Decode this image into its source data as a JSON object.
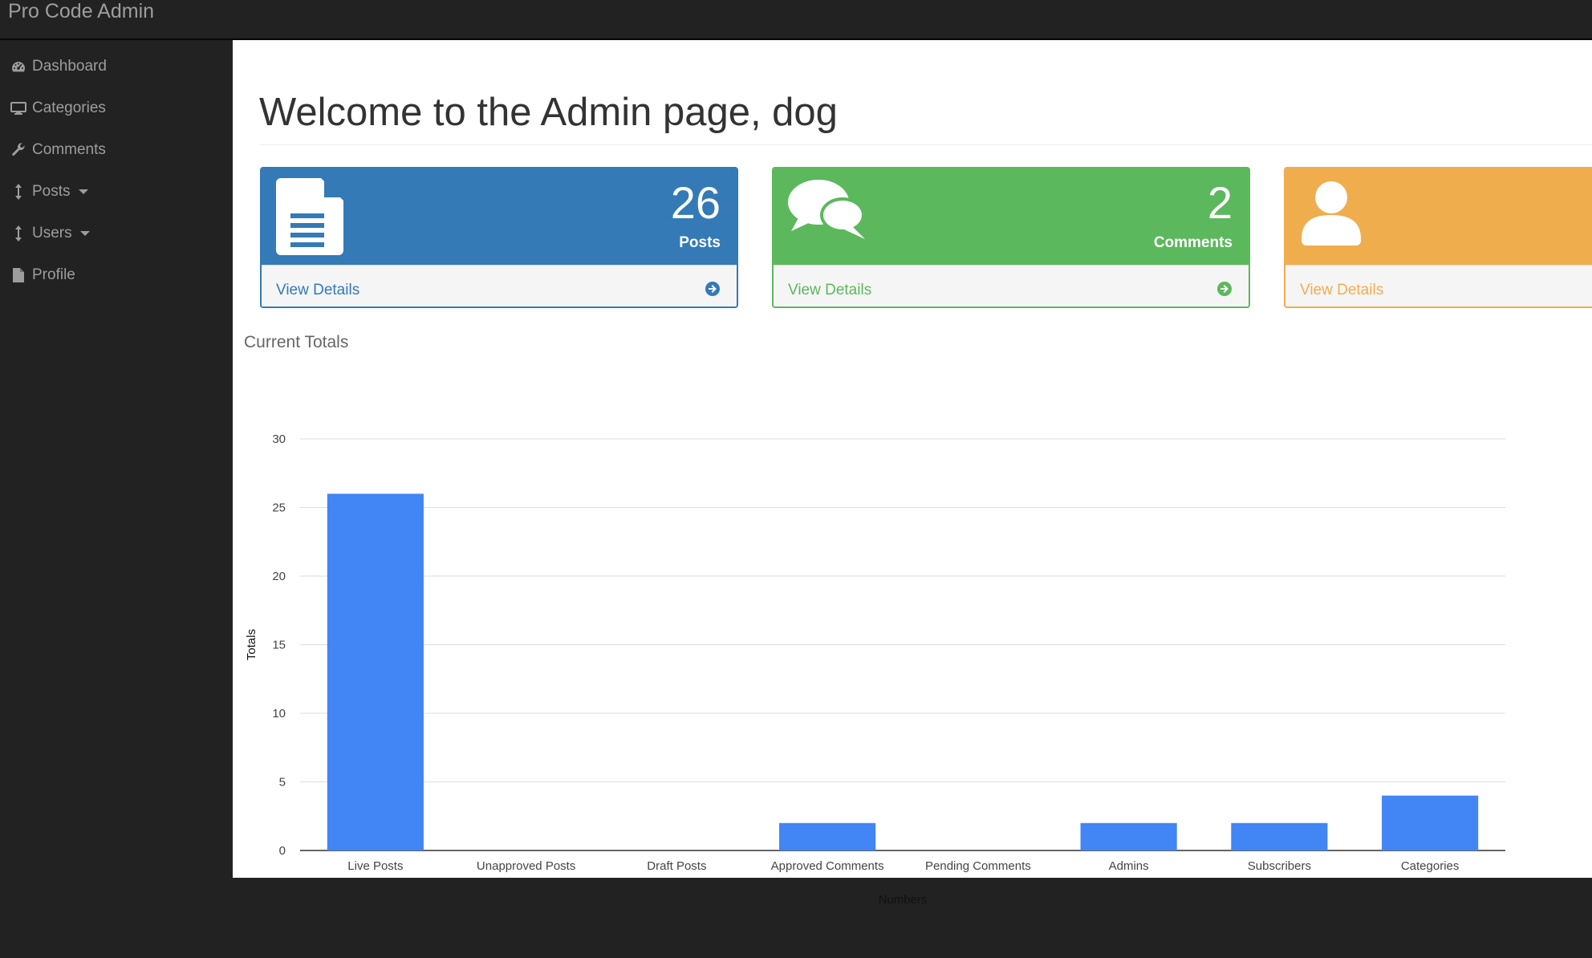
{
  "app": {
    "brand": "Pro Code Admin"
  },
  "sidebar": {
    "items": [
      {
        "label": "Dashboard",
        "icon": "dashboard-icon",
        "dropdown": false
      },
      {
        "label": "Categories",
        "icon": "desktop-icon",
        "dropdown": false
      },
      {
        "label": "Comments",
        "icon": "wrench-icon",
        "dropdown": false
      },
      {
        "label": "Posts",
        "icon": "arrows-vertical-icon",
        "dropdown": true
      },
      {
        "label": "Users",
        "icon": "arrows-vertical-icon",
        "dropdown": true
      },
      {
        "label": "Profile",
        "icon": "file-icon",
        "dropdown": false
      }
    ]
  },
  "main": {
    "title": "Welcome to the Admin page, dog",
    "panels": [
      {
        "count": "26",
        "label": "Posts",
        "link": "View Details",
        "color": "#337ab7",
        "icon": "file-text-icon"
      },
      {
        "count": "2",
        "label": "Comments",
        "link": "View Details",
        "color": "#5cb85c",
        "icon": "comments-icon"
      },
      {
        "count": "",
        "label": "",
        "link": "View Details",
        "color": "#f0ad4e",
        "icon": "user-icon"
      }
    ],
    "chart_heading": "Current Totals"
  },
  "chart_data": {
    "type": "bar",
    "categories": [
      "Live Posts",
      "Unapproved Posts",
      "Draft Posts",
      "Approved Comments",
      "Pending Comments",
      "Admins",
      "Subscribers",
      "Categories"
    ],
    "values": [
      26,
      0,
      0,
      2,
      0,
      2,
      2,
      4
    ],
    "xlabel": "Numbers",
    "ylabel": "Totals",
    "ylim": [
      0,
      30
    ],
    "yticks": [
      0,
      5,
      10,
      15,
      20,
      25,
      30
    ],
    "bar_color": "#4285f4",
    "grid": true
  }
}
